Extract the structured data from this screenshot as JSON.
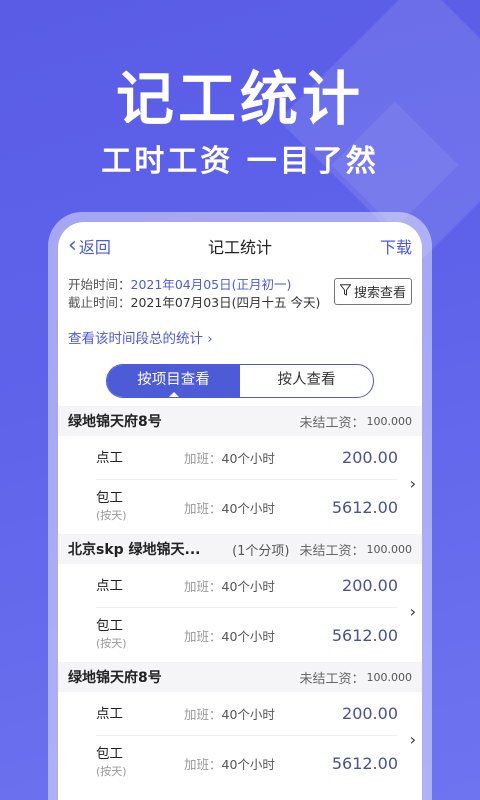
{
  "promo": {
    "title": "记工统计",
    "subtitle": "工时工资 一目了然"
  },
  "nav": {
    "back": "返回",
    "title": "记工统计",
    "action": "下载"
  },
  "range": {
    "start_label": "开始时间：",
    "start_value": "2021年04月05日(正月初一)",
    "end_label": "截止时间：",
    "end_value": "2021年07月03日(四月十五 今天)",
    "search_button": "搜索查看",
    "period_link": "查看该时间段总的统计 ›"
  },
  "segmented": {
    "options": [
      "按项目查看",
      "按人查看"
    ],
    "active": 0
  },
  "groups": [
    {
      "name": "绿地锦天府8号",
      "branch": "",
      "unpaid_label": "未结工资：",
      "unpaid_value": "100.000",
      "rows": [
        {
          "type": "点工",
          "note": "",
          "ot_label": "加班：",
          "ot_value": "40个小时",
          "amount": "200.00"
        },
        {
          "type": "包工",
          "note": "(按天)",
          "ot_label": "加班：",
          "ot_value": "40个小时",
          "amount": "5612.00"
        }
      ]
    },
    {
      "name": "北京skp 绿地锦天...",
      "branch": "(1个分项)",
      "unpaid_label": "未结工资：",
      "unpaid_value": "100.000",
      "rows": [
        {
          "type": "点工",
          "note": "",
          "ot_label": "加班：",
          "ot_value": "40个小时",
          "amount": "200.00"
        },
        {
          "type": "包工",
          "note": "(按天)",
          "ot_label": "加班：",
          "ot_value": "40个小时",
          "amount": "5612.00"
        }
      ]
    },
    {
      "name": "绿地锦天府8号",
      "branch": "",
      "unpaid_label": "未结工资：",
      "unpaid_value": "100.000",
      "rows": [
        {
          "type": "点工",
          "note": "",
          "ot_label": "加班：",
          "ot_value": "40个小时",
          "amount": "200.00"
        },
        {
          "type": "包工",
          "note": "(按天)",
          "ot_label": "加班：",
          "ot_value": "40个小时",
          "amount": "5612.00"
        }
      ]
    }
  ],
  "colors": {
    "accent": "#4d5bd6",
    "background": "#5f63ea",
    "amount": "#4a4f9a"
  },
  "icons": {
    "back": "chevron-left-icon",
    "search": "funnel-icon",
    "row_arrow": "chevron-right-icon"
  }
}
